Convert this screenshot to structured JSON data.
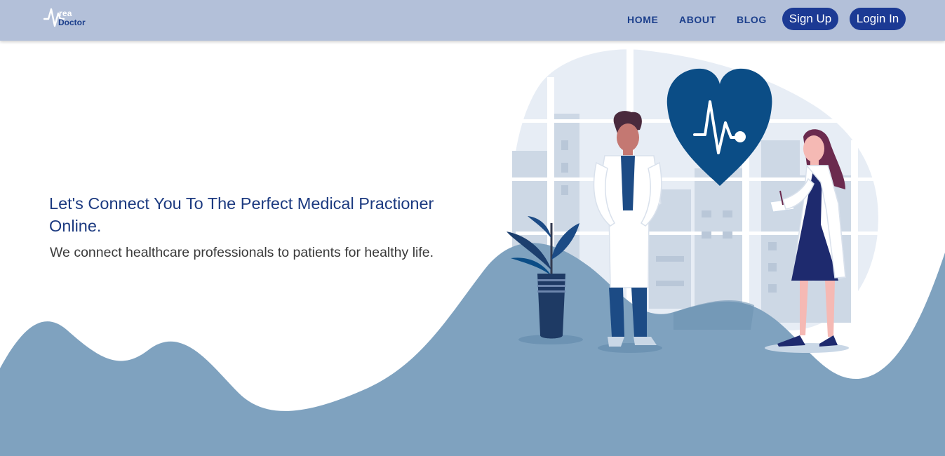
{
  "brand": {
    "logo_top": "rea",
    "logo_bottom": "Doctor"
  },
  "nav": {
    "home": "HOME",
    "about": "ABOUT",
    "blog": "BLOG",
    "signup": "Sign Up",
    "login": "Login In"
  },
  "hero": {
    "heading": "Let's Connect You To The Perfect Medical Practioner Online.",
    "subheading": "We connect healthcare professionals to patients for healthy life."
  },
  "colors": {
    "header_bg": "#b3c0d9",
    "nav_text": "#1c3f8c",
    "button_bg": "#1c3a94",
    "wave": "#7fa2bf",
    "heart": "#0b4d86"
  },
  "icons": {
    "logo": "heartbeat-logo-icon",
    "heart": "heart-pulse-icon"
  }
}
